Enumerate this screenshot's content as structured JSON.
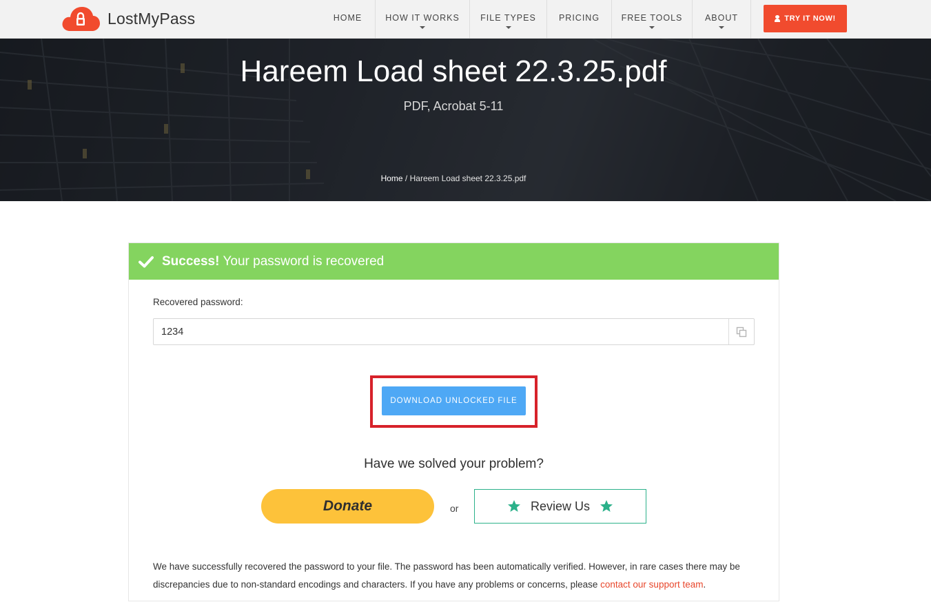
{
  "header": {
    "brand": "LostMyPass",
    "nav": [
      {
        "label": "HOME",
        "has_caret": false
      },
      {
        "label": "HOW IT WORKS",
        "has_caret": true
      },
      {
        "label": "FILE TYPES",
        "has_caret": true
      },
      {
        "label": "PRICING",
        "has_caret": false
      },
      {
        "label": "FREE TOOLS",
        "has_caret": true
      },
      {
        "label": "ABOUT",
        "has_caret": true
      }
    ],
    "cta_label": "TRY IT NOW!",
    "accent_color": "#f14b2e"
  },
  "hero": {
    "title": "Hareem Load sheet 22.3.25.pdf",
    "subtitle": "PDF, Acrobat 5-11",
    "breadcrumb": {
      "home": "Home",
      "separator": " / ",
      "current": "Hareem Load sheet 22.3.25.pdf"
    }
  },
  "result": {
    "status_strong": "Success!",
    "status_text": "Your password is recovered",
    "status_color": "#84d45f",
    "password_label": "Recovered password:",
    "password_value": "1234",
    "download_label": "DOWNLOAD UNLOCKED FILE",
    "question": "Have we solved your problem?",
    "donate_label": "Donate",
    "or_label": "or",
    "review_label": "Review Us",
    "note_text": "We have successfully recovered the password to your file. The password has been automatically verified. However, in rare cases there may be discrepancies due to non-standard encodings and characters. If you have any problems or concerns, please ",
    "note_link": "contact our support team",
    "note_end": "."
  },
  "icons": {
    "logo": "cloud-lock-icon",
    "cta": "user-icon",
    "status": "check-icon",
    "copy": "copy-icon",
    "review": "star-icon"
  }
}
